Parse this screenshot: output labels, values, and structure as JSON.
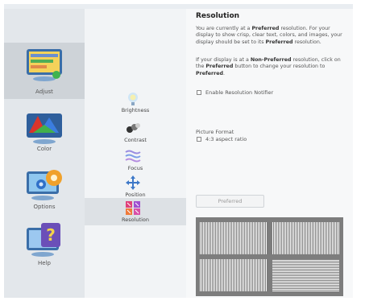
{
  "sidebar": {
    "items": [
      {
        "label": "Adjust",
        "icon": "adjust-icon",
        "active": true
      },
      {
        "label": "Color",
        "icon": "color-icon",
        "active": false
      },
      {
        "label": "Options",
        "icon": "options-icon",
        "active": false
      },
      {
        "label": "Help",
        "icon": "help-icon",
        "active": false
      }
    ]
  },
  "submenu": {
    "items": [
      {
        "label": "Brightness",
        "icon": "brightness-icon",
        "active": false
      },
      {
        "label": "Contrast",
        "icon": "contrast-icon",
        "active": false
      },
      {
        "label": "Focus",
        "icon": "focus-icon",
        "active": false
      },
      {
        "label": "Position",
        "icon": "position-icon",
        "active": false
      },
      {
        "label": "Resolution",
        "icon": "resolution-icon",
        "active": true
      }
    ]
  },
  "content": {
    "title": "Resolution",
    "para1": {
      "t1": "You are currently at a ",
      "b1": "Preferred",
      "t2": " resolution. For your display to show crisp, clear text, colors, and images, your display should be set to its ",
      "b2": "Preferred",
      "t3": " resolution."
    },
    "para2": {
      "t1": "If your display is at a ",
      "b1": "Non-Preferred",
      "t2": " resolution, click on the ",
      "b2": "Preferred",
      "t3": " button to change your resolution to ",
      "b3": "Preferred",
      "t4": "."
    },
    "enable_notifier_label": "Enable Resolution Notifier",
    "picture_format_label": "Picture Format",
    "aspect_label": "4:3 aspect ratio",
    "preferred_button": "Preferred"
  },
  "colors": {
    "left_bg": "#e3e7eb",
    "left_active": "#ced3d8",
    "mid_bg": "#f2f4f6",
    "right_bg": "#f7f8f9",
    "pattern_gray": "#7d7d7d"
  }
}
